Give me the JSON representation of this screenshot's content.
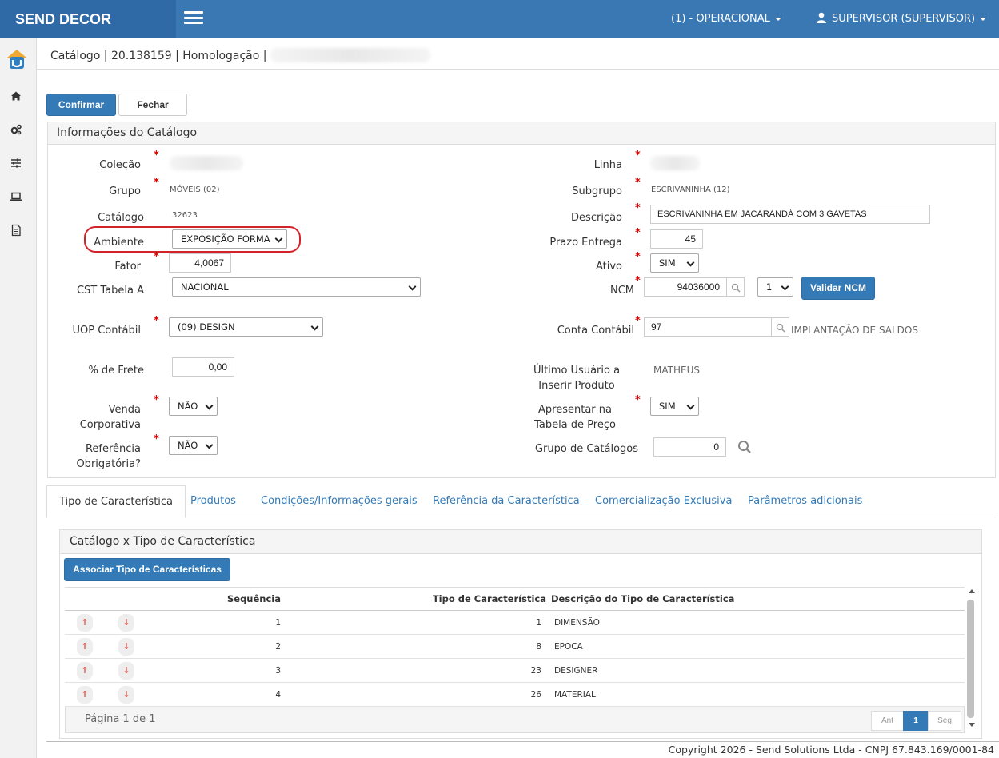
{
  "app": {
    "brand": "SEND DECOR"
  },
  "topbar": {
    "operation": "(1) - OPERACIONAL",
    "user": "SUPERVISOR (SUPERVISOR)"
  },
  "sidebar": {
    "icons": [
      "home-icon",
      "cogs-icon",
      "sliders-icon",
      "laptop-icon",
      "document-icon"
    ]
  },
  "breadcrumb": "Catálogo | 20.138159 | Homologação |",
  "toolbar": {
    "confirm": "Confirmar",
    "close": "Fechar"
  },
  "panel": {
    "title": "Informações do Catálogo"
  },
  "form": {
    "colecao_label": "Coleção",
    "linha_label": "Linha",
    "grupo_label": "Grupo",
    "grupo_value": "MÓVEIS (02)",
    "subgrupo_label": "Subgrupo",
    "subgrupo_value": "ESCRIVANINHA (12)",
    "catalogo_label": "Catálogo",
    "catalogo_value": "32623",
    "descricao_label": "Descrição",
    "descricao_value": "ESCRIVANINHA EM JACARANDÁ COM 3 GAVETAS",
    "ambiente_label": "Ambiente",
    "ambiente_value": "EXPOSIÇÃO FORMA",
    "prazo_label": "Prazo Entrega",
    "prazo_value": "45",
    "fator_label": "Fator",
    "fator_value": "4,0067",
    "ativo_label": "Ativo",
    "ativo_value": "SIM",
    "cst_label": "CST Tabela A",
    "cst_value": "NACIONAL",
    "ncm_label": "NCM",
    "ncm_value": "94036000",
    "ncm_seq": "1",
    "validar_ncm": "Validar NCM",
    "uop_label": "UOP Contábil",
    "uop_value": "(09) DESIGN",
    "conta_label": "Conta Contábil",
    "conta_value": "97",
    "conta_desc": "IMPLANTAÇÃO DE SALDOS",
    "frete_label": "% de Frete",
    "frete_value": "0,00",
    "ultimo_label_1": "Último Usuário a",
    "ultimo_label_2": "Inserir Produto",
    "ultimo_value": "MATHEUS",
    "venda_label": "Venda Corporativa",
    "venda_value": "NÃO",
    "apresentar_label_1": "Apresentar na",
    "apresentar_label_2": "Tabela de Preço",
    "apresentar_value": "SIM",
    "ref_label_1": "Referência",
    "ref_label_2": "Obrigatória?",
    "ref_value": "NÃO",
    "grupo_cat_label": "Grupo de Catálogos",
    "grupo_cat_value": "0",
    "required_mark": "*"
  },
  "tabs": [
    {
      "label": "Tipo de Característica"
    },
    {
      "label": "Produtos"
    },
    {
      "label": "Condições/Informações gerais"
    },
    {
      "label": "Referência da Característica"
    },
    {
      "label": "Comercialização Exclusiva"
    },
    {
      "label": "Parâmetros adicionais"
    }
  ],
  "subpanel": {
    "title": "Catálogo x Tipo de Característica",
    "associate_button": "Associar Tipo de Características",
    "columns": [
      "Sequência",
      "Tipo de Característica",
      "Descrição do Tipo de Característica"
    ],
    "rows": [
      {
        "seq": "1",
        "tipo": "1",
        "desc": "DIMENSÃO"
      },
      {
        "seq": "2",
        "tipo": "8",
        "desc": "EPOCA"
      },
      {
        "seq": "3",
        "tipo": "23",
        "desc": "DESIGNER"
      },
      {
        "seq": "4",
        "tipo": "26",
        "desc": "MATERIAL"
      }
    ],
    "page_info": "Página 1 de 1",
    "pager": {
      "prev": "Ant",
      "current": "1",
      "next": "Seg"
    },
    "arrow_up": "↑",
    "arrow_down": "↓"
  },
  "footer": "Copyright 2026 - Send Solutions Ltda - CNPJ 67.843.169/0001-84",
  "colors": {
    "topbar": "#3a78b4",
    "brand": "#2f6aa6",
    "primary": "#337ab7",
    "required": "#dd0000",
    "highlight": "#d2232a"
  }
}
